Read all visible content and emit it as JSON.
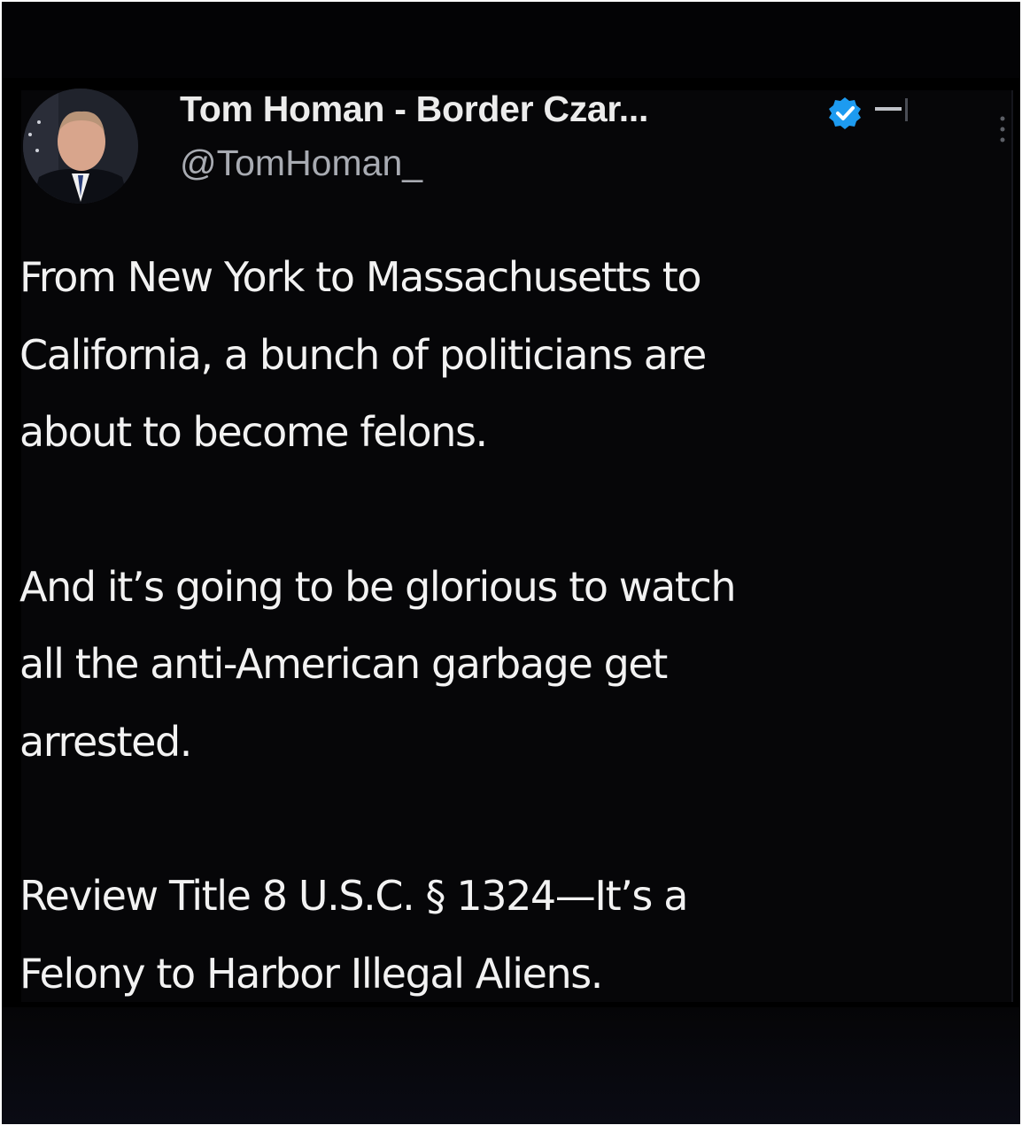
{
  "post": {
    "author": {
      "display_name": "Tom Homan - Border Czar...",
      "handle": "@TomHoman_",
      "verified": true,
      "avatar_icon": "profile-photo-icon",
      "verified_icon": "verified-badge-icon"
    },
    "paragraphs": [
      "From New York to Massachusetts to\nCalifornia, a bunch of politicians are\nabout to become felons.",
      "And it’s going to be glorious to watch\nall the anti-American garbage get\narrested.",
      "Review Title 8 U.S.C. § 1324—It’s a\nFelony to Harbor Illegal Aliens."
    ]
  },
  "colors": {
    "background": "#000000",
    "text": "#f2f2f2",
    "handle": "#a8abb2",
    "verified_badge": "#1d9bf0"
  }
}
